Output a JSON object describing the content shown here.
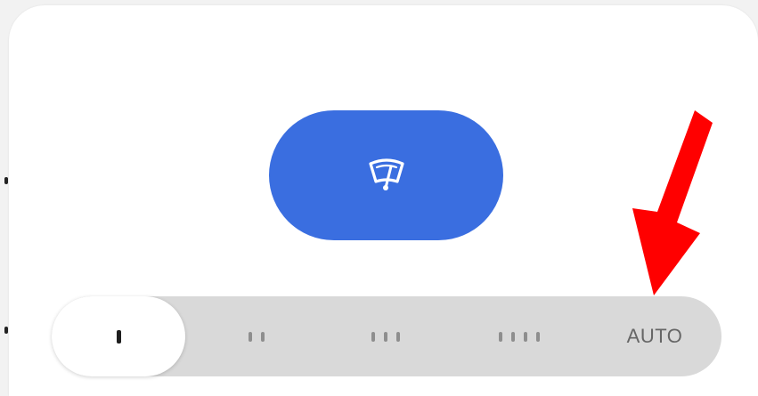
{
  "wiper": {
    "button_icon": "windshield-wiper-icon",
    "button_color": "#3a6ee0"
  },
  "speed_selector": {
    "options": [
      {
        "name": "speed-1",
        "bars": 1,
        "selected": true
      },
      {
        "name": "speed-2",
        "bars": 2,
        "selected": false
      },
      {
        "name": "speed-3",
        "bars": 3,
        "selected": false
      },
      {
        "name": "speed-4",
        "bars": 4,
        "selected": false
      },
      {
        "name": "auto",
        "label": "AUTO",
        "selected": false
      }
    ]
  },
  "annotation": {
    "arrow_color": "#ff0000",
    "arrow_icon": "red-arrow-pointing-down"
  }
}
